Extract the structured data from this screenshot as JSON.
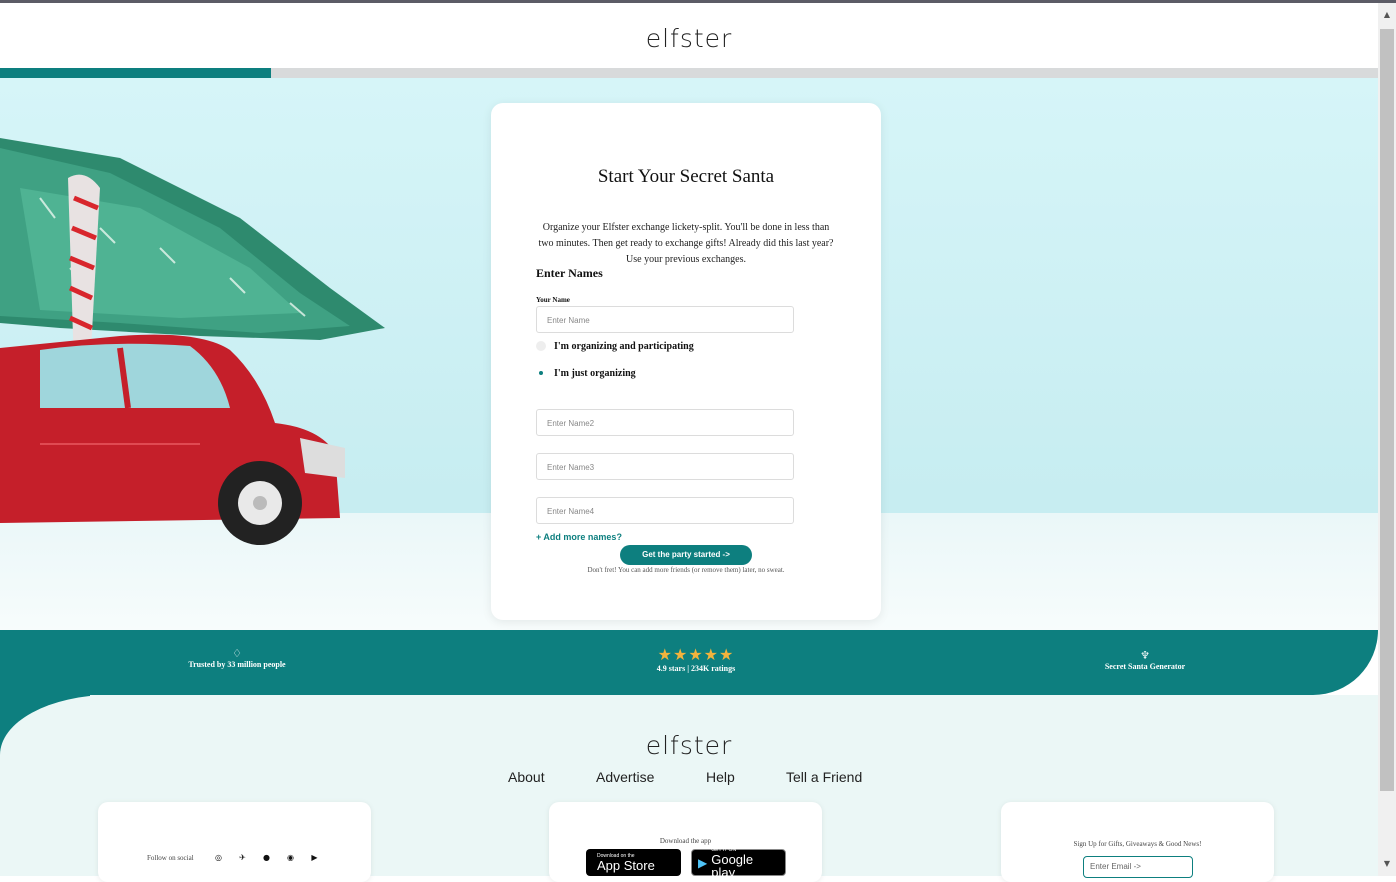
{
  "header": {
    "logo": "elfster",
    "progress": 0.197
  },
  "colors": {
    "brand": "#0d7f7f",
    "star": "#f2b33d",
    "footer_bg": "#ebf7f6"
  },
  "card": {
    "title": "Start Your Secret Santa",
    "intro": "Organize your Elfster exchange lickety-split. You'll be done in less than two minutes. Then get ready to exchange gifts! Already did this last year? Use your previous exchanges.",
    "section_title": "Enter Names",
    "your_name_label": "Your Name",
    "name1_placeholder": "Enter Name",
    "radio_participating": "I'm organizing and participating",
    "radio_organizing": "I'm just organizing",
    "name2_placeholder": "Enter Name2",
    "name3_placeholder": "Enter Name3",
    "name4_placeholder": "Enter Name4",
    "add_more": "+ Add more names?",
    "cta": "Get the party started ->",
    "cta_note": "Don't fret! You can add more friends (or remove them) later, no sweat."
  },
  "band": {
    "trusted": "Trusted by 33 million people",
    "trusted_icon": "diamond-icon",
    "rating_stars": "★★★★★",
    "rating_text": "4.9 stars | 234K ratings",
    "generator": "Secret Santa Generator",
    "generator_icon": "trophy-icon"
  },
  "footer": {
    "logo": "elfster",
    "nav": [
      "About",
      "Advertise",
      "Help",
      "Tell a Friend"
    ],
    "follow_label": "Follow on social",
    "download_label": "Download the app",
    "appstore_small": "Download on the",
    "appstore_large": "App Store",
    "googleplay_small": "GET IT ON",
    "googleplay_large": "Google play",
    "signup_label": "Sign Up for Gifts, Giveaways & Good News!",
    "email_placeholder": "Enter Email    ->"
  }
}
